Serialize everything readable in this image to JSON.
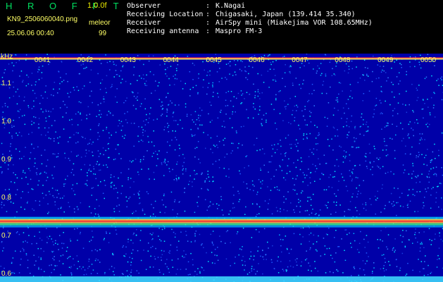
{
  "header": {
    "title": "H R O F F T",
    "version": "1.0.0f",
    "filename": "KN9_2506060040.png",
    "code": "meleor",
    "datetime": "25.06.06 00:40",
    "value": "99"
  },
  "info": [
    {
      "label": "Observer",
      "value": "K.Nagai"
    },
    {
      "label": "Receiving Location",
      "value": "Chigasaki, Japan (139.414 35.340)"
    },
    {
      "label": "Receiver",
      "value": "AirSpy mini (Miakejima VOR 108.65MHz)"
    },
    {
      "label": "Receiving antenna",
      "value": "Maspro FM-3"
    }
  ],
  "chart_data": {
    "type": "heatmap",
    "ylabel": "kHz",
    "y_ticks": [
      "1.1",
      "1.0",
      "0.9",
      "0.8",
      "0.7",
      "0.6"
    ],
    "x_ticks": [
      "0041",
      "0042",
      "0043",
      "0044",
      "0045",
      "0046",
      "0047",
      "0048",
      "0049",
      "0050"
    ],
    "ylim": [
      0.58,
      1.18
    ],
    "xlim": [
      "0040",
      "0050"
    ],
    "carrier_khz": 0.74,
    "top_band_khz": 1.17,
    "colors": {
      "background": "#0000a8",
      "noise": "#2a64ff",
      "signal": "#ff3030",
      "tick": "#ffff66"
    }
  }
}
